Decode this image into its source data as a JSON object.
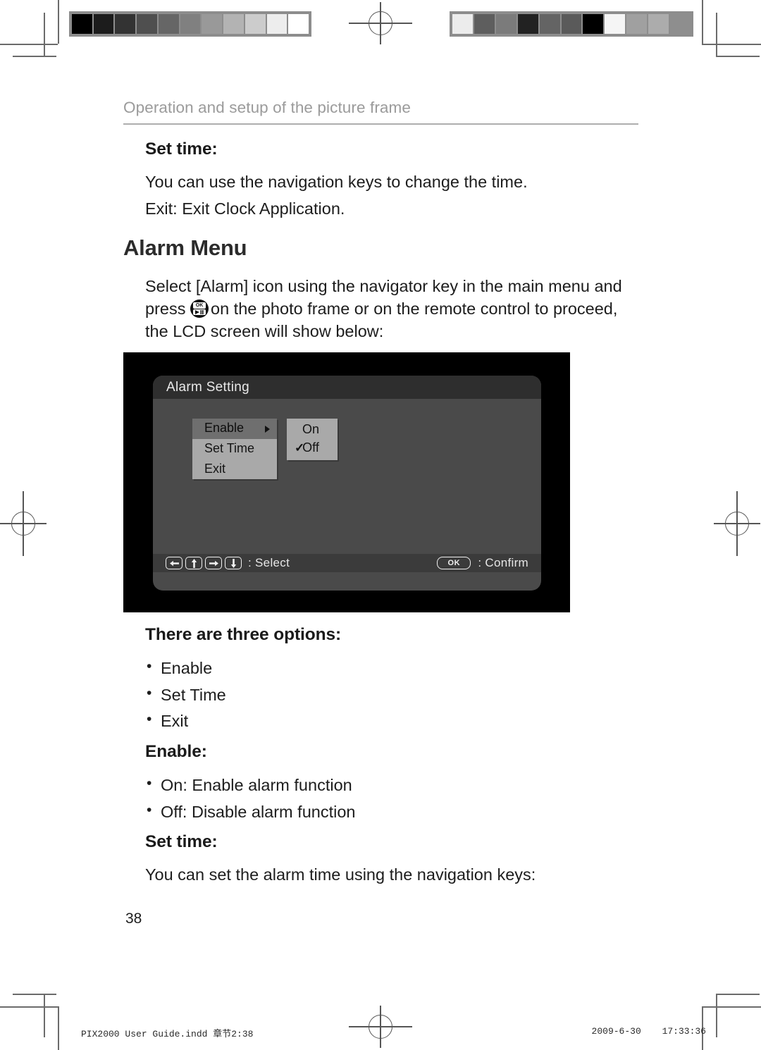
{
  "running_head": "Operation and setup of the picture frame",
  "sections": [
    {
      "heading": "Set time:",
      "lines": [
        "You can use the navigation keys to change the time.",
        "Exit: Exit Clock Application."
      ]
    }
  ],
  "chapter_title": "Alarm Menu",
  "intro": {
    "before_icon": "Select [Alarm] icon using the navigator key in the main menu and press",
    "icon_name": "ok-play-button-icon",
    "icon_label": "OK",
    "after_icon": "on the photo frame or on the remote control to proceed, the LCD screen will show below:"
  },
  "lcd": {
    "title": "Alarm Setting",
    "menu": [
      {
        "label": "Enable",
        "selected": true,
        "has_submenu": true
      },
      {
        "label": "Set Time",
        "selected": false,
        "has_submenu": false
      },
      {
        "label": "Exit",
        "selected": false,
        "has_submenu": false
      }
    ],
    "submenu": [
      {
        "label": "On",
        "checked": false
      },
      {
        "label": "Off",
        "checked": true
      }
    ],
    "footer": {
      "select_label": ": Select",
      "confirm_key": "OK",
      "confirm_label": ": Confirm",
      "keys": [
        "arrow-left",
        "arrow-up",
        "arrow-right",
        "arrow-down"
      ]
    }
  },
  "options_heading": "There are three options:",
  "options": [
    "Enable",
    "Set Time",
    "Exit"
  ],
  "enable_heading": "Enable:",
  "enable_options": [
    "On: Enable alarm function",
    "Off: Disable alarm function"
  ],
  "settime_heading": "Set time:",
  "settime_text": "You can set the alarm time using the navigation keys:",
  "page_number": "38",
  "colophon": {
    "file": "PIX2000 User Guide.indd   章节2:38",
    "date": "2009-6-30",
    "time": "17:33:36"
  },
  "calibration": {
    "left_patches": [
      "#000000",
      "#1c1c1c",
      "#333333",
      "#4f4f4f",
      "#666666",
      "#808080",
      "#999999",
      "#b3b3b3",
      "#cccccc",
      "#ededed",
      "#ffffff"
    ],
    "right_patches": [
      "#ececec",
      "#5e5e5e",
      "#7b7b7b",
      "#222222",
      "#646464",
      "#5a5a5a",
      "#000000",
      "#f5f5f5",
      "#a0a0a0",
      "#acacac",
      "#8e8e8e"
    ]
  }
}
